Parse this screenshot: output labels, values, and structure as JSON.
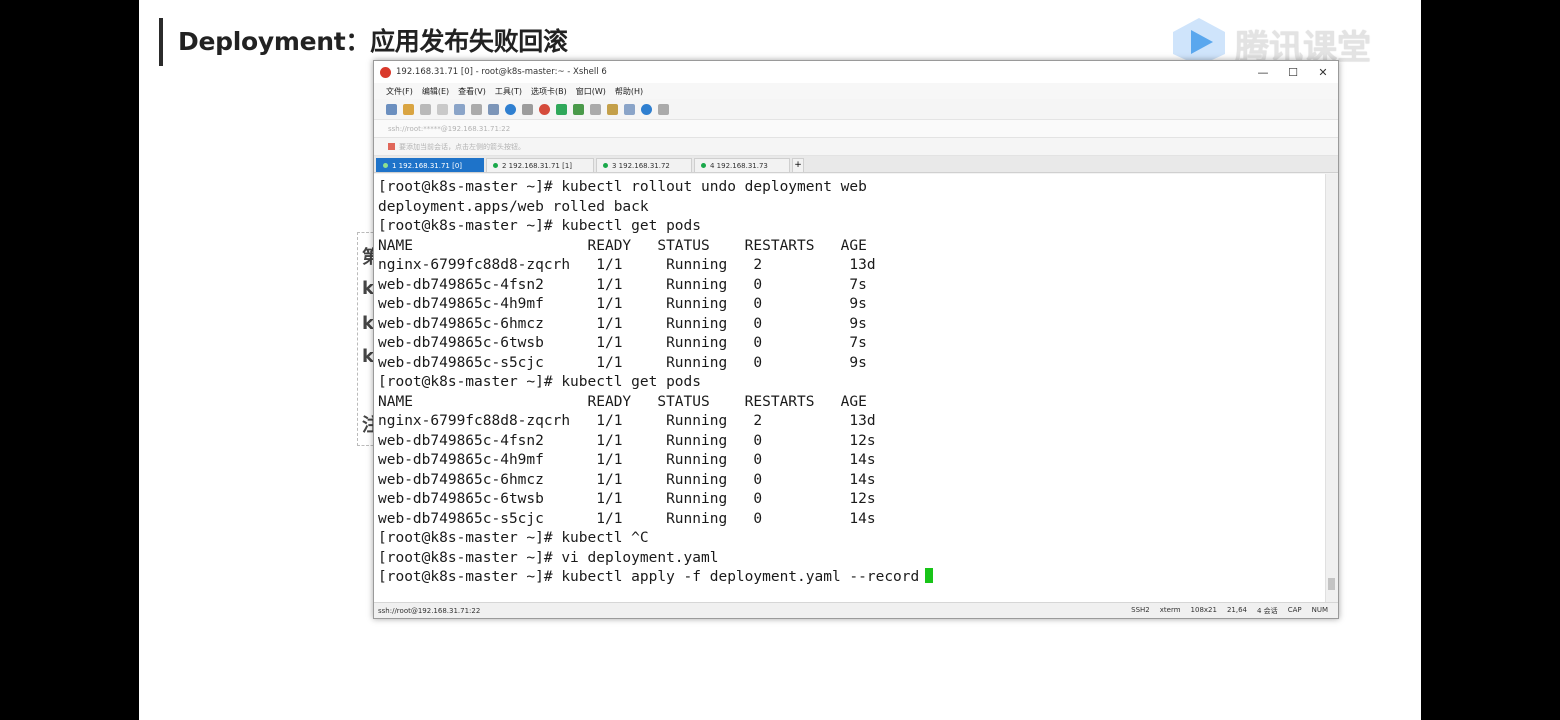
{
  "slide": {
    "title": "Deployment：应用发布失败回滚",
    "logo_text": "腾讯课堂"
  },
  "background_doc_glyphs": [
    "第",
    "k",
    "k",
    "k",
    "注"
  ],
  "window": {
    "title": "192.168.31.71 [0] - root@k8s-master:~ - Xshell 6",
    "minimize": "—",
    "maximize": "☐",
    "close": "✕"
  },
  "menu": [
    "文件(F)",
    "编辑(E)",
    "查看(V)",
    "工具(T)",
    "选项卡(B)",
    "窗口(W)",
    "帮助(H)"
  ],
  "address_bar": "ssh://root:*****@192.168.31.71:22",
  "hint_bar": "要添加当前会话，点击左侧的箭头按钮。",
  "tabs": [
    {
      "label": "1 192.168.31.71 [0]",
      "active": true
    },
    {
      "label": "2 192.168.31.71 [1]",
      "active": false
    },
    {
      "label": "3 192.168.31.72",
      "active": false
    },
    {
      "label": "4 192.168.31.73",
      "active": false
    }
  ],
  "tab_add": "+",
  "terminal_lines": [
    "[root@k8s-master ~]# kubectl rollout undo deployment web",
    "deployment.apps/web rolled back",
    "[root@k8s-master ~]# kubectl get pods",
    "NAME                    READY   STATUS    RESTARTS   AGE",
    "nginx-6799fc88d8-zqcrh   1/1     Running   2          13d",
    "web-db749865c-4fsn2      1/1     Running   0          7s",
    "web-db749865c-4h9mf      1/1     Running   0          9s",
    "web-db749865c-6hmcz      1/1     Running   0          9s",
    "web-db749865c-6twsb      1/1     Running   0          7s",
    "web-db749865c-s5cjc      1/1     Running   0          9s",
    "[root@k8s-master ~]# kubectl get pods",
    "NAME                    READY   STATUS    RESTARTS   AGE",
    "nginx-6799fc88d8-zqcrh   1/1     Running   2          13d",
    "web-db749865c-4fsn2      1/1     Running   0          12s",
    "web-db749865c-4h9mf      1/1     Running   0          14s",
    "web-db749865c-6hmcz      1/1     Running   0          14s",
    "web-db749865c-6twsb      1/1     Running   0          12s",
    "web-db749865c-s5cjc      1/1     Running   0          14s",
    "[root@k8s-master ~]# kubectl ^C",
    "[root@k8s-master ~]# vi deployment.yaml",
    "[root@k8s-master ~]# kubectl apply -f deployment.yaml --record"
  ],
  "status_bar": {
    "connection": "ssh://root@192.168.31.71:22",
    "protocol": "SSH2",
    "term": "xterm",
    "size": "108x21",
    "position": "21,64",
    "sessions": "4 会话",
    "caps": "CAP",
    "num": "NUM"
  },
  "colors": {
    "active_tab": "#1e73c9",
    "cursor": "#18c418",
    "close_icon": "#d9392b"
  }
}
